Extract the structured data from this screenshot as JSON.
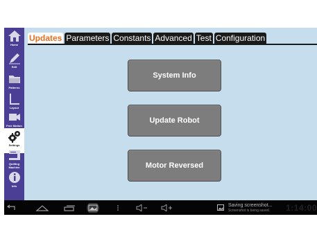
{
  "sidebar": {
    "items": [
      {
        "label": "Home",
        "icon": "home-icon"
      },
      {
        "label": "Edit",
        "icon": "pencil-icon"
      },
      {
        "label": "Patterns",
        "icon": "folder-icon"
      },
      {
        "label": "Layout",
        "icon": "layout-icon"
      },
      {
        "label": "Free Motion",
        "icon": "camera-icon"
      },
      {
        "label": "Settings",
        "icon": "gears-icon",
        "active": true
      },
      {
        "label": "Quilting Machine",
        "icon": "sewing-machine-icon"
      },
      {
        "label": "Info",
        "icon": "info-icon"
      }
    ]
  },
  "tabs": [
    "Updates",
    "Parameters",
    "Constants",
    "Advanced",
    "Test",
    "Configuration"
  ],
  "active_tab": "Updates",
  "buttons": {
    "system_info": "System Info",
    "update_robot": "Update Robot",
    "motor_reversed": "Motor Reversed"
  },
  "navbar": {
    "notification_title": "Saving screenshot...",
    "notification_subtitle": "Screenshot is being saved.",
    "clock": "1:14:00"
  },
  "colors": {
    "sidebar_bg": "#4a3f95",
    "content_bg": "#c6ddee",
    "active_tab_text": "#e9701d",
    "button_bg": "#7d7d7d"
  }
}
